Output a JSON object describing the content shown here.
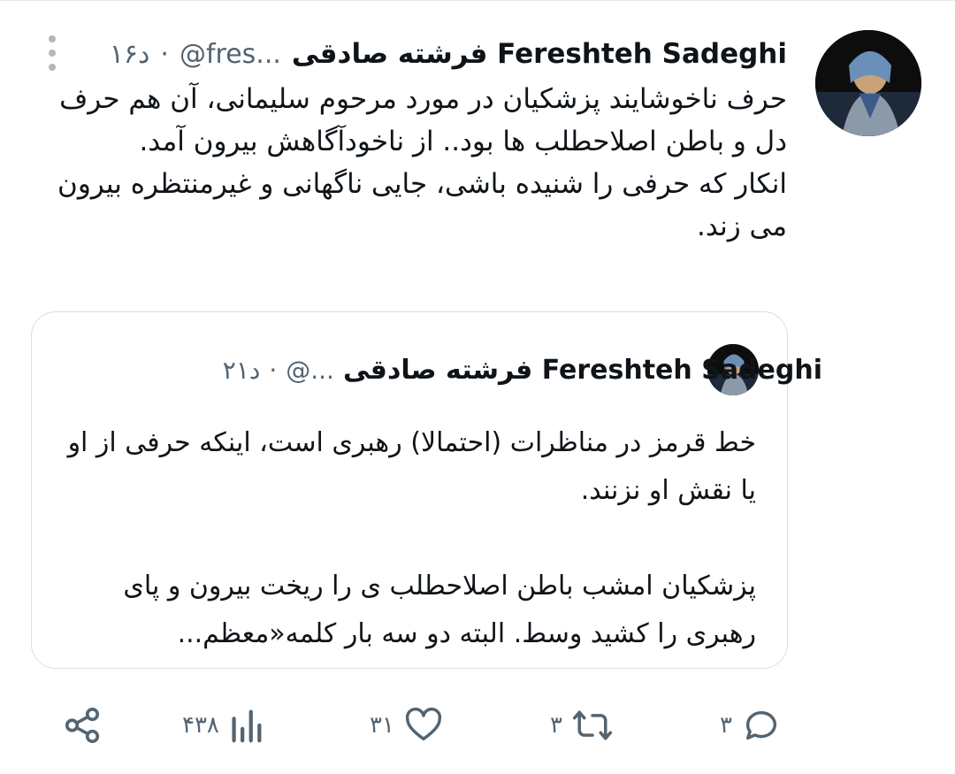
{
  "tweet": {
    "author_name": "فرشته صادقی Fereshteh Sadeghi",
    "handle": "@fres...",
    "separator": "·",
    "time": "۱۶د",
    "text_lines": [
      "حرف ناخوشایند پزشکیان در مورد مرحوم سلیمانی، آن هم حرف دل و باطن اصلاحطلب ها بود.. از ناخودآگاهش بیرون آمد.",
      "انکار که حرفی را شنیده باشی، جایی ناگهانی و غیرمنتظره بیرون می زند."
    ]
  },
  "quoted_tweet": {
    "author_name": "فرشته صادقی Fereshteh Sadeghi",
    "handle": "@...",
    "separator": "·",
    "time": "۲۱د",
    "paragraph_1": "خط قرمز در مناظرات (احتمالا) رهبری است، اینکه حرفی از او یا نقش او نزنند.",
    "paragraph_2": "پزشکیان امشب باطن اصلاحطلب ی را ریخت بیرون و پای رهبری را کشید وسط. البته دو سه بار کلمه«معظم..."
  },
  "actions": {
    "replies": "۳",
    "retweets": "۳",
    "likes": "۳۱",
    "views": "۴۳۸"
  },
  "colors": {
    "text": "#0f1419",
    "muted": "#536471",
    "border": "#d9dde1"
  },
  "icons": [
    "more-vertical-icon",
    "reply-icon",
    "retweet-icon",
    "like-icon",
    "views-icon",
    "share-icon"
  ]
}
